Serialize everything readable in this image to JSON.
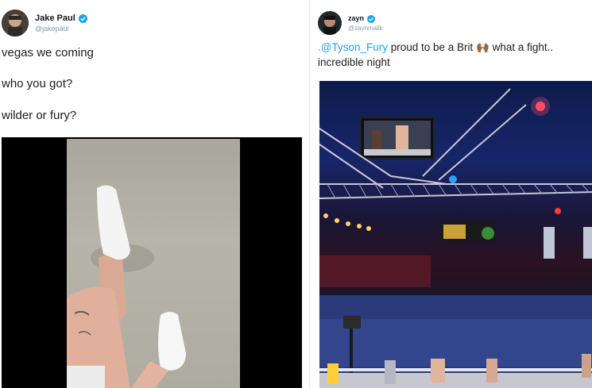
{
  "tweets": [
    {
      "display_name": "Jake Paul",
      "handle": "@jakepaul",
      "lines": [
        "vegas we coming",
        "who you got?",
        "wilder or fury?"
      ]
    },
    {
      "display_name": "zayn",
      "handle": "@zaynmalik",
      "mention": ".@Tyson_Fury",
      "text_after_mention": " proud to be a Brit 🙌🏾 what a fight..",
      "line2": "incredible night"
    }
  ],
  "colors": {
    "verified": "#1da1f2",
    "mention": "#1da1f2",
    "divider": "#e1e8ed"
  },
  "icons": {
    "verified": "verified-badge-icon"
  }
}
